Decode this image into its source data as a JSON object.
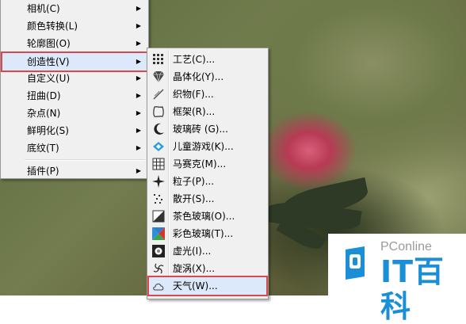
{
  "left_menu": {
    "items": [
      {
        "label": "相机(C)",
        "has_submenu": true
      },
      {
        "label": "颜色转换(L)",
        "has_submenu": true
      },
      {
        "label": "轮廓图(O)",
        "has_submenu": true
      },
      {
        "label": "创造性(V)",
        "has_submenu": true,
        "highlighted": true
      },
      {
        "label": "自定义(U)",
        "has_submenu": true
      },
      {
        "label": "扭曲(D)",
        "has_submenu": true
      },
      {
        "label": "杂点(N)",
        "has_submenu": true
      },
      {
        "label": "鲜明化(S)",
        "has_submenu": true
      },
      {
        "label": "底纹(T)",
        "has_submenu": true
      },
      {
        "label": "插件(P)",
        "has_submenu": true
      }
    ]
  },
  "creative_submenu": {
    "items": [
      {
        "label": "工艺(C)...",
        "icon": "craft-grid-icon"
      },
      {
        "label": "晶体化(Y)...",
        "icon": "crystal-diamond-icon"
      },
      {
        "label": "织物(F)...",
        "icon": "fabric-icon"
      },
      {
        "label": "框架(R)...",
        "icon": "frame-icon"
      },
      {
        "label": "玻璃砖 (G)...",
        "icon": "glass-block-icon"
      },
      {
        "label": "儿童游戏(K)...",
        "icon": "kids-play-icon"
      },
      {
        "label": "马赛克(M)...",
        "icon": "mosaic-icon"
      },
      {
        "label": "粒子(P)...",
        "icon": "particles-icon"
      },
      {
        "label": "散开(S)...",
        "icon": "scatter-icon"
      },
      {
        "label": "茶色玻璃(O)...",
        "icon": "smoked-glass-icon"
      },
      {
        "label": "彩色玻璃(T)...",
        "icon": "stained-glass-icon"
      },
      {
        "label": "虚光(I)...",
        "icon": "vignette-icon"
      },
      {
        "label": "旋涡(X)...",
        "icon": "vortex-icon"
      },
      {
        "label": "天气(W)...",
        "icon": "weather-cloud-icon",
        "highlighted": true
      }
    ]
  },
  "watermark": {
    "small_text": "PConline",
    "brand_text": "IT百科",
    "color": "#1b8fd6"
  }
}
